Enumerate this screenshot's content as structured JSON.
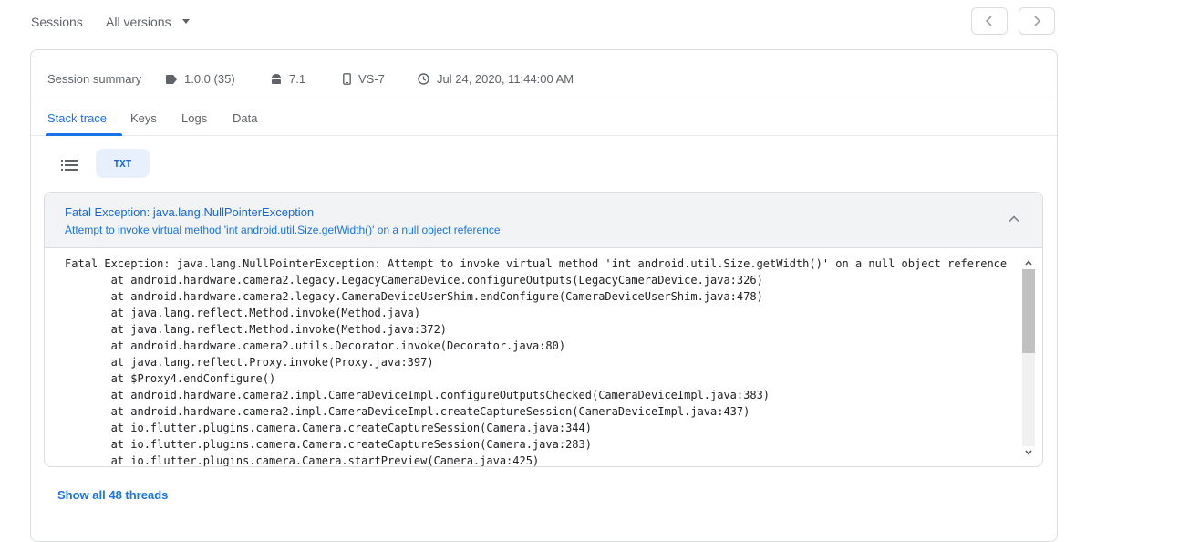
{
  "topbar": {
    "sessions_label": "Sessions",
    "versions_label": "All versions"
  },
  "summary": {
    "title": "Session summary",
    "app_version": "1.0.0 (35)",
    "os_version": "7.1",
    "device": "VS-7",
    "timestamp": "Jul 24, 2020, 11:44:00 AM"
  },
  "tabs": [
    "Stack trace",
    "Keys",
    "Logs",
    "Data"
  ],
  "view_toggle": {
    "txt_label": "TXT"
  },
  "exception": {
    "title": "Fatal Exception: java.lang.NullPointerException",
    "subtitle": "Attempt to invoke virtual method 'int android.util.Size.getWidth()' on a null object reference",
    "trace": [
      "Fatal Exception: java.lang.NullPointerException: Attempt to invoke virtual method 'int android.util.Size.getWidth()' on a null object reference",
      "       at android.hardware.camera2.legacy.LegacyCameraDevice.configureOutputs(LegacyCameraDevice.java:326)",
      "       at android.hardware.camera2.legacy.CameraDeviceUserShim.endConfigure(CameraDeviceUserShim.java:478)",
      "       at java.lang.reflect.Method.invoke(Method.java)",
      "       at java.lang.reflect.Method.invoke(Method.java:372)",
      "       at android.hardware.camera2.utils.Decorator.invoke(Decorator.java:80)",
      "       at java.lang.reflect.Proxy.invoke(Proxy.java:397)",
      "       at $Proxy4.endConfigure()",
      "       at android.hardware.camera2.impl.CameraDeviceImpl.configureOutputsChecked(CameraDeviceImpl.java:383)",
      "       at android.hardware.camera2.impl.CameraDeviceImpl.createCaptureSession(CameraDeviceImpl.java:437)",
      "       at io.flutter.plugins.camera.Camera.createCaptureSession(Camera.java:344)",
      "       at io.flutter.plugins.camera.Camera.createCaptureSession(Camera.java:283)",
      "       at io.flutter.plugins.camera.Camera.startPreview(Camera.java:425)"
    ]
  },
  "show_threads_label": "Show all 48 threads",
  "colors": {
    "accent": "#1a73e8",
    "header_bg": "#f1f3f4",
    "txt_toggle_bg": "#e8f0fe"
  },
  "icons": [
    "chevron-left-icon",
    "chevron-right-icon",
    "tag-icon",
    "android-icon",
    "phone-icon",
    "clock-icon",
    "list-icon",
    "chevron-up-icon"
  ]
}
